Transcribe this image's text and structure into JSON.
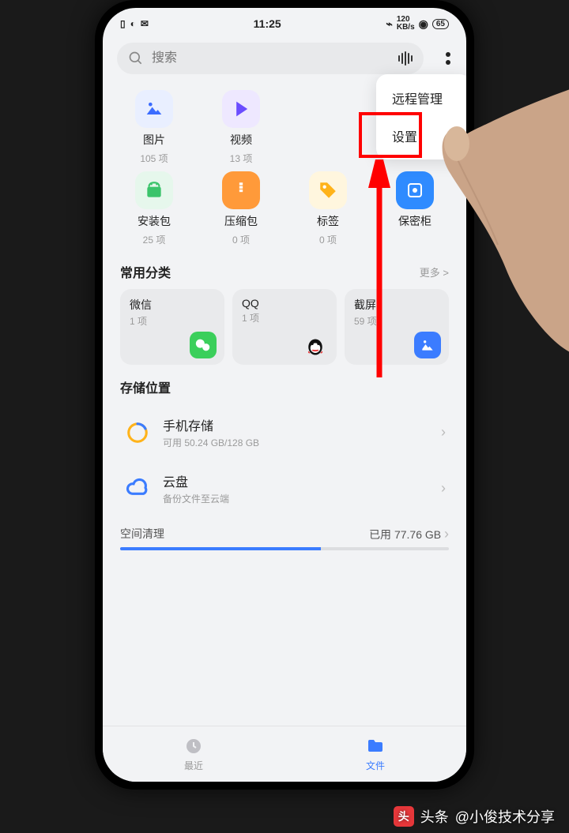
{
  "status": {
    "time": "11:25",
    "net_speed": "120",
    "net_unit": "KB/s",
    "battery": "65"
  },
  "search": {
    "placeholder": "搜索"
  },
  "popover": {
    "remote": "远程管理",
    "settings": "设置"
  },
  "categories": [
    {
      "label": "图片",
      "count": "105 项",
      "icon": "photo",
      "bg": "#e9efff",
      "fg": "#3b6cff"
    },
    {
      "label": "视频",
      "count": "13 项",
      "icon": "video",
      "bg": "#eee8ff",
      "fg": "#6b4dff"
    },
    {
      "label": "",
      "count": "",
      "icon": "",
      "bg": "",
      "fg": ""
    },
    {
      "label": "",
      "count": "",
      "icon": "",
      "bg": "",
      "fg": ""
    },
    {
      "label": "安装包",
      "count": "25 项",
      "icon": "apk",
      "bg": "#e6f7ec",
      "fg": "#3bc46b"
    },
    {
      "label": "压缩包",
      "count": "0 项",
      "icon": "archive",
      "bg": "#fff0e0",
      "fg": "#ff8a2a"
    },
    {
      "label": "标签",
      "count": "0 项",
      "icon": "tag",
      "bg": "#fff6de",
      "fg": "#ffb31a"
    },
    {
      "label": "保密柜",
      "count": "",
      "icon": "safe",
      "bg": "#e3f1ff",
      "fg": "#2f8bff"
    }
  ],
  "common": {
    "title": "常用分类",
    "more": "更多 >",
    "items": [
      {
        "label": "微信",
        "count": "1 项",
        "icon": "wechat"
      },
      {
        "label": "QQ",
        "count": "1 项",
        "icon": "qq"
      },
      {
        "label": "截屏",
        "count": "59 项",
        "icon": "screenshot"
      }
    ]
  },
  "storage": {
    "title": "存储位置",
    "items": [
      {
        "name": "手机存储",
        "sub": "可用 50.24 GB/128 GB",
        "icon": "disk"
      },
      {
        "name": "云盘",
        "sub": "备份文件至云端",
        "icon": "cloud"
      }
    ]
  },
  "cleanup": {
    "label": "空间清理",
    "used": "已用 77.76 GB",
    "percent": 61
  },
  "bottomnav": {
    "recent": "最近",
    "files": "文件"
  },
  "watermark": {
    "prefix": "头条",
    "author": "@小俊技术分享"
  }
}
